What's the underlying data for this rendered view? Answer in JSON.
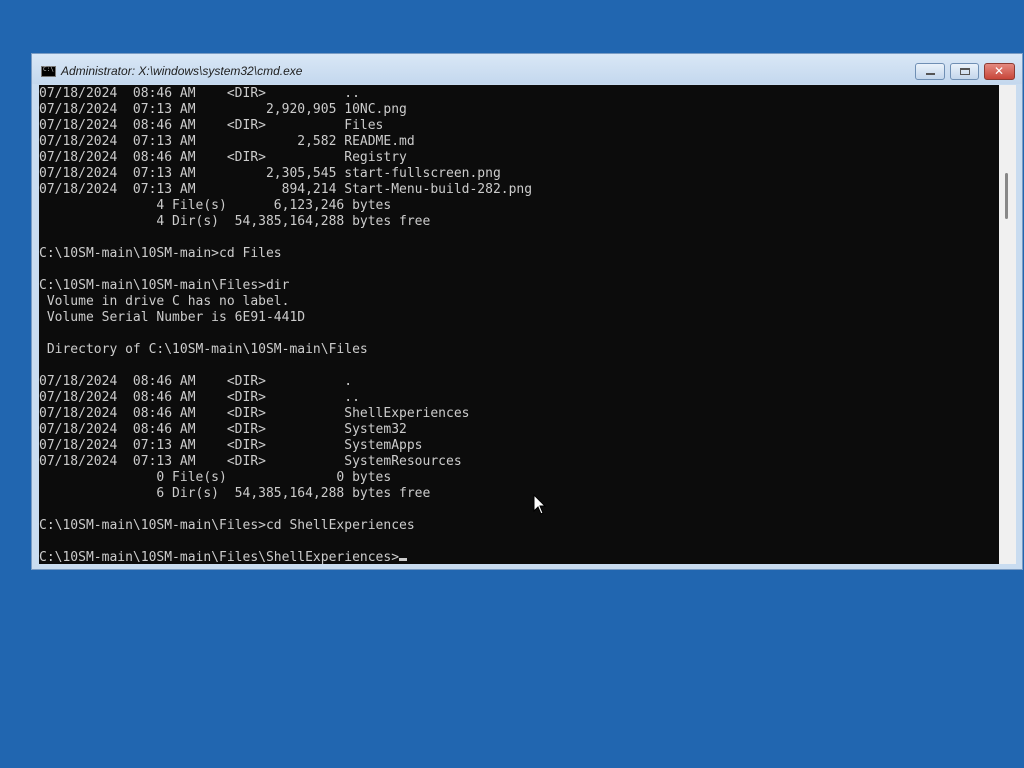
{
  "window": {
    "title": "Administrator: X:\\windows\\system32\\cmd.exe",
    "icon": "cmd-icon"
  },
  "console": {
    "lines": [
      "07/18/2024  08:46 AM    <DIR>          ..",
      "07/18/2024  07:13 AM         2,920,905 10NC.png",
      "07/18/2024  08:46 AM    <DIR>          Files",
      "07/18/2024  07:13 AM             2,582 README.md",
      "07/18/2024  08:46 AM    <DIR>          Registry",
      "07/18/2024  07:13 AM         2,305,545 start-fullscreen.png",
      "07/18/2024  07:13 AM           894,214 Start-Menu-build-282.png",
      "               4 File(s)      6,123,246 bytes",
      "               4 Dir(s)  54,385,164,288 bytes free",
      "",
      "C:\\10SM-main\\10SM-main>cd Files",
      "",
      "C:\\10SM-main\\10SM-main\\Files>dir",
      " Volume in drive C has no label.",
      " Volume Serial Number is 6E91-441D",
      "",
      " Directory of C:\\10SM-main\\10SM-main\\Files",
      "",
      "07/18/2024  08:46 AM    <DIR>          .",
      "07/18/2024  08:46 AM    <DIR>          ..",
      "07/18/2024  08:46 AM    <DIR>          ShellExperiences",
      "07/18/2024  08:46 AM    <DIR>          System32",
      "07/18/2024  07:13 AM    <DIR>          SystemApps",
      "07/18/2024  07:13 AM    <DIR>          SystemResources",
      "               0 File(s)              0 bytes",
      "               6 Dir(s)  54,385,164,288 bytes free",
      "",
      "C:\\10SM-main\\10SM-main\\Files>cd ShellExperiences",
      ""
    ],
    "prompt": "C:\\10SM-main\\10SM-main\\Files\\ShellExperiences>"
  },
  "colors": {
    "desktop": "#2166b0",
    "console_bg": "#0c0c0c",
    "console_fg": "#cccccc"
  }
}
